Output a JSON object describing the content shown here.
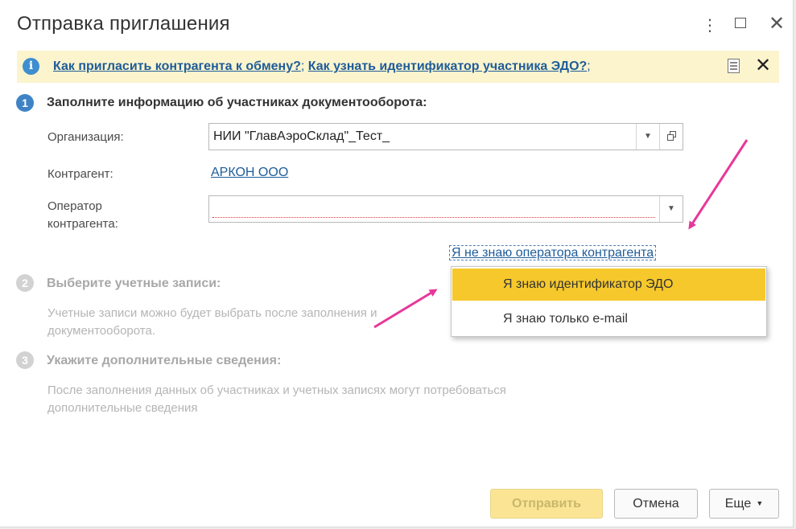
{
  "window": {
    "title": "Отправка приглашения",
    "more_icon": "⋮",
    "maximize_icon": "maximize-icon",
    "close_icon": "✕"
  },
  "infobar": {
    "icon": "i",
    "link1": "Как пригласить контрагента к обмену?",
    "sep1": ";",
    "link2": "Как узнать идентификатор участника ЭДО?",
    "sep2": ";",
    "close_icon": "✕"
  },
  "step1": {
    "number": "1",
    "title": "Заполните информацию об участниках документооборота:",
    "org_label": "Организация:",
    "org_value": "НИИ \"ГлавАэроСклад\"_Тест_",
    "counterparty_label": "Контрагент:",
    "counterparty_value": "АРКОН ООО",
    "operator_label_line1": "Оператор",
    "operator_label_line2": "контрагента:",
    "operator_value": "",
    "unknown_operator_link": "Я не знаю оператора контрагента"
  },
  "step2": {
    "number": "2",
    "title": "Выберите учетные записи:",
    "desc_line1": "Учетные записи можно будет выбрать после заполнения и",
    "desc_line2": "документооборота."
  },
  "step3": {
    "number": "3",
    "title": "Укажите дополнительные сведения:",
    "desc_line1": "После заполнения данных об участниках и учетных записях могут потребоваться",
    "desc_line2": "дополнительные сведения"
  },
  "dropdown": {
    "items": [
      {
        "label": "Я знаю идентификатор ЭДО",
        "selected": true
      },
      {
        "label": "Я знаю только e-mail",
        "selected": false
      }
    ]
  },
  "buttons": {
    "send": "Отправить",
    "cancel": "Отмена",
    "more": "Еще"
  },
  "colors": {
    "accent_blue": "#3f83c6",
    "link": "#1e5c9a",
    "highlight": "#f6c82b",
    "annotation_arrow": "#e8379a"
  }
}
